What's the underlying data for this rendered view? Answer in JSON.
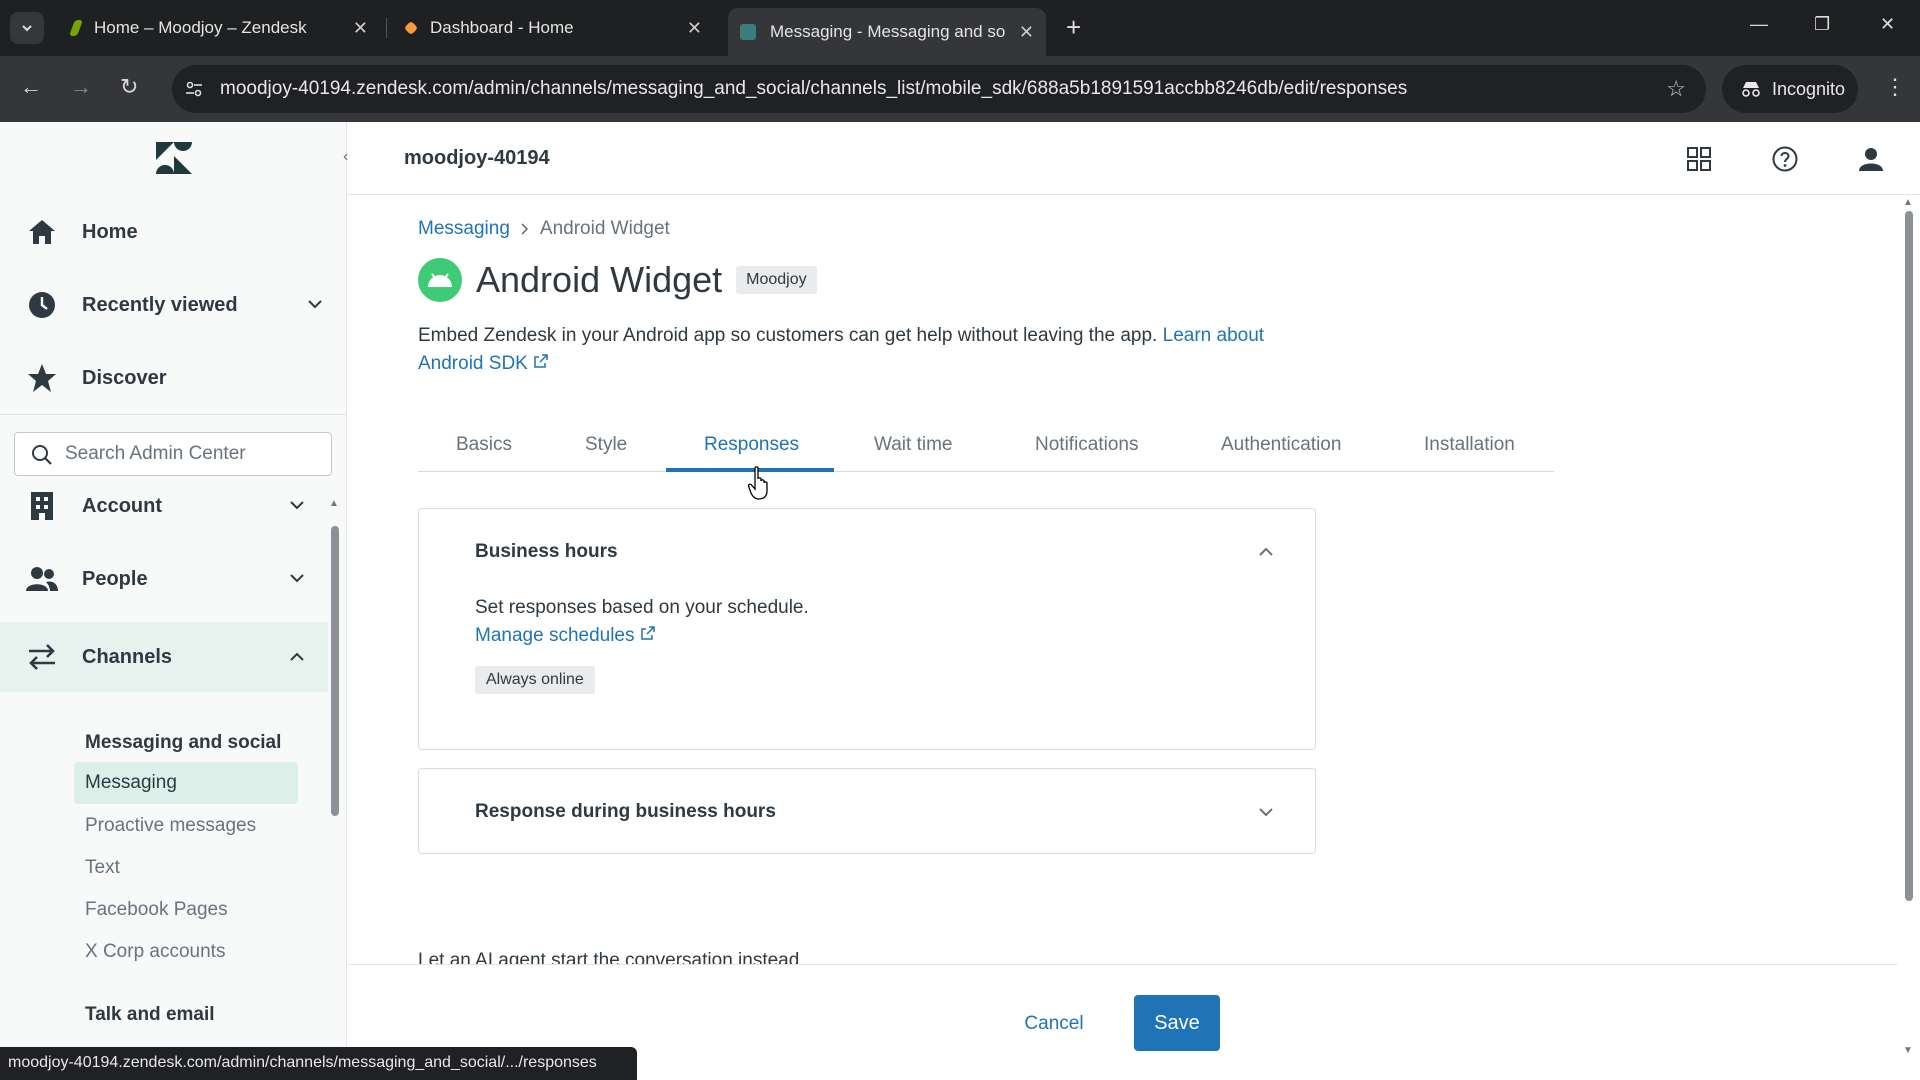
{
  "browser": {
    "tabs": [
      {
        "title": "Home – Moodjoy – Zendesk",
        "active": false
      },
      {
        "title": "Dashboard - Home",
        "active": false
      },
      {
        "title": "Messaging - Messaging and so",
        "active": true
      }
    ],
    "url": "moodjoy-40194.zendesk.com/admin/channels/messaging_and_social/channels_list/mobile_sdk/688a5b1891591accbb8246db/edit/responses",
    "incognito_label": "Incognito",
    "status_url": "moodjoy-40194.zendesk.com/admin/channels/messaging_and_social/.../responses"
  },
  "sidebar": {
    "search_placeholder": "Search Admin Center",
    "top_items": [
      {
        "label": "Home",
        "icon": "home-icon"
      },
      {
        "label": "Recently viewed",
        "icon": "clock-icon"
      },
      {
        "label": "Discover",
        "icon": "star-icon"
      }
    ],
    "sections": [
      {
        "label": "Account",
        "icon": "building-icon"
      },
      {
        "label": "People",
        "icon": "people-icon"
      },
      {
        "label": "Channels",
        "icon": "channels-icon"
      }
    ],
    "channels_sub": {
      "heading": "Messaging and social",
      "items": [
        "Messaging",
        "Proactive messages",
        "Text",
        "Facebook Pages",
        "X Corp accounts"
      ],
      "next_heading": "Talk and email"
    }
  },
  "topbar": {
    "account": "moodjoy-40194"
  },
  "page": {
    "breadcrumb": {
      "parent": "Messaging",
      "current": "Android Widget"
    },
    "title": "Android Widget",
    "brand_badge": "Moodjoy",
    "description": "Embed Zendesk in your Android app so customers can get help without leaving the app.",
    "learn_link": "Learn about Android SDK",
    "tabs": [
      "Basics",
      "Style",
      "Responses",
      "Wait time",
      "Notifications",
      "Authentication",
      "Installation"
    ],
    "active_tab": "Responses",
    "business_hours": {
      "title": "Business hours",
      "text": "Set responses based on your schedule.",
      "link": "Manage schedules",
      "tag": "Always online"
    },
    "response_card": {
      "title": "Response during business hours"
    },
    "ai_text": "Let an AI agent start the conversation instead"
  },
  "footer": {
    "cancel": "Cancel",
    "save": "Save"
  },
  "colors": {
    "accent": "#1f73b7",
    "brand_green": "#3fca75",
    "active_bg": "#e6f2ee"
  }
}
